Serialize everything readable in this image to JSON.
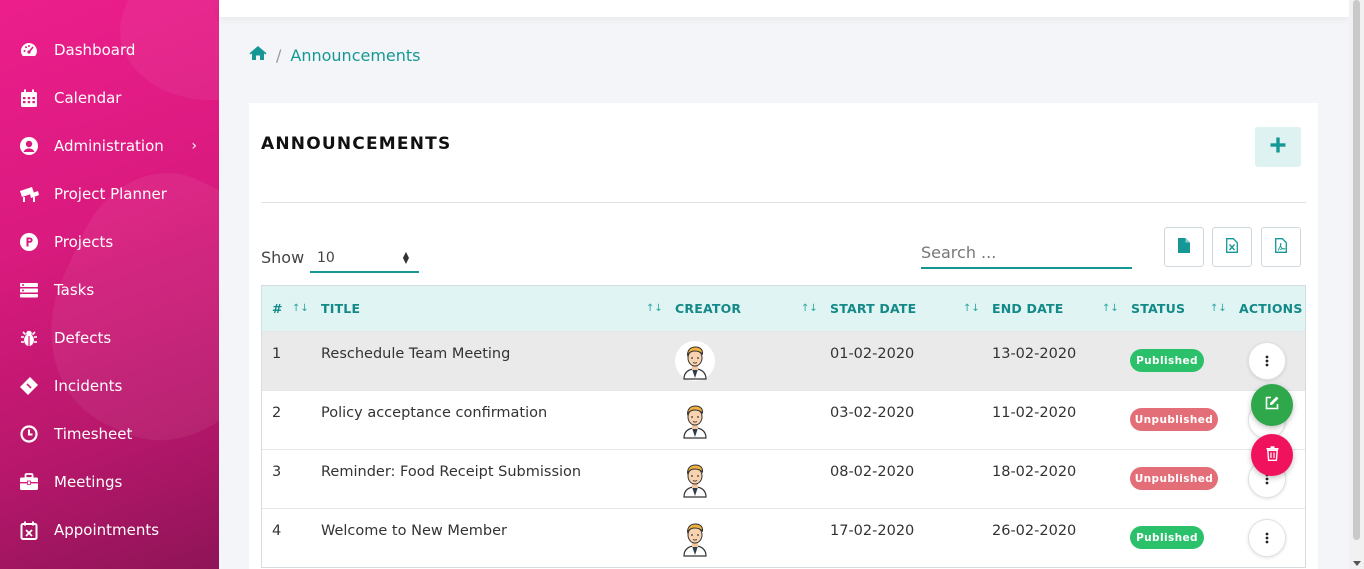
{
  "sidebar": {
    "items": [
      {
        "label": "Dashboard",
        "icon": "dashboard-icon"
      },
      {
        "label": "Calendar",
        "icon": "calendar-icon"
      },
      {
        "label": "Administration",
        "icon": "user-circle-icon"
      },
      {
        "label": "Project Planner",
        "icon": "planner-icon"
      },
      {
        "label": "Projects",
        "icon": "projects-icon"
      },
      {
        "label": "Tasks",
        "icon": "tasks-icon"
      },
      {
        "label": "Defects",
        "icon": "bug-icon"
      },
      {
        "label": "Incidents",
        "icon": "ticket-icon"
      },
      {
        "label": "Timesheet",
        "icon": "clock-icon"
      },
      {
        "label": "Meetings",
        "icon": "briefcase-icon"
      },
      {
        "label": "Appointments",
        "icon": "calendar-x-icon"
      }
    ]
  },
  "breadcrumb": {
    "home_icon": "home-icon",
    "separator": "/",
    "current": "Announcements"
  },
  "card": {
    "title": "ANNOUNCEMENTS"
  },
  "controls": {
    "show_label": "Show",
    "page_size": "10",
    "search_placeholder": "Search ..."
  },
  "table": {
    "columns": {
      "num": "#",
      "title": "TITLE",
      "creator": "CREATOR",
      "start": "START DATE",
      "end": "END DATE",
      "status": "STATUS",
      "actions": "ACTIONS"
    },
    "rows": [
      {
        "num": "1",
        "title": "Reschedule Team Meeting",
        "start": "01-02-2020",
        "end": "13-02-2020",
        "status": "Published"
      },
      {
        "num": "2",
        "title": "Policy acceptance confirmation",
        "start": "03-02-2020",
        "end": "11-02-2020",
        "status": "Unpublished"
      },
      {
        "num": "3",
        "title": "Reminder: Food Receipt Submission",
        "start": "08-02-2020",
        "end": "18-02-2020",
        "status": "Unpublished"
      },
      {
        "num": "4",
        "title": "Welcome to New Member",
        "start": "17-02-2020",
        "end": "26-02-2020",
        "status": "Published"
      }
    ]
  },
  "colors": {
    "sidebar_start": "#ec1e8c",
    "sidebar_end": "#8e1457",
    "accent": "#159895",
    "published": "#2bc16a",
    "unpublished": "#e46e78",
    "edit_fab": "#2ea84a",
    "delete_fab": "#f0125c"
  }
}
